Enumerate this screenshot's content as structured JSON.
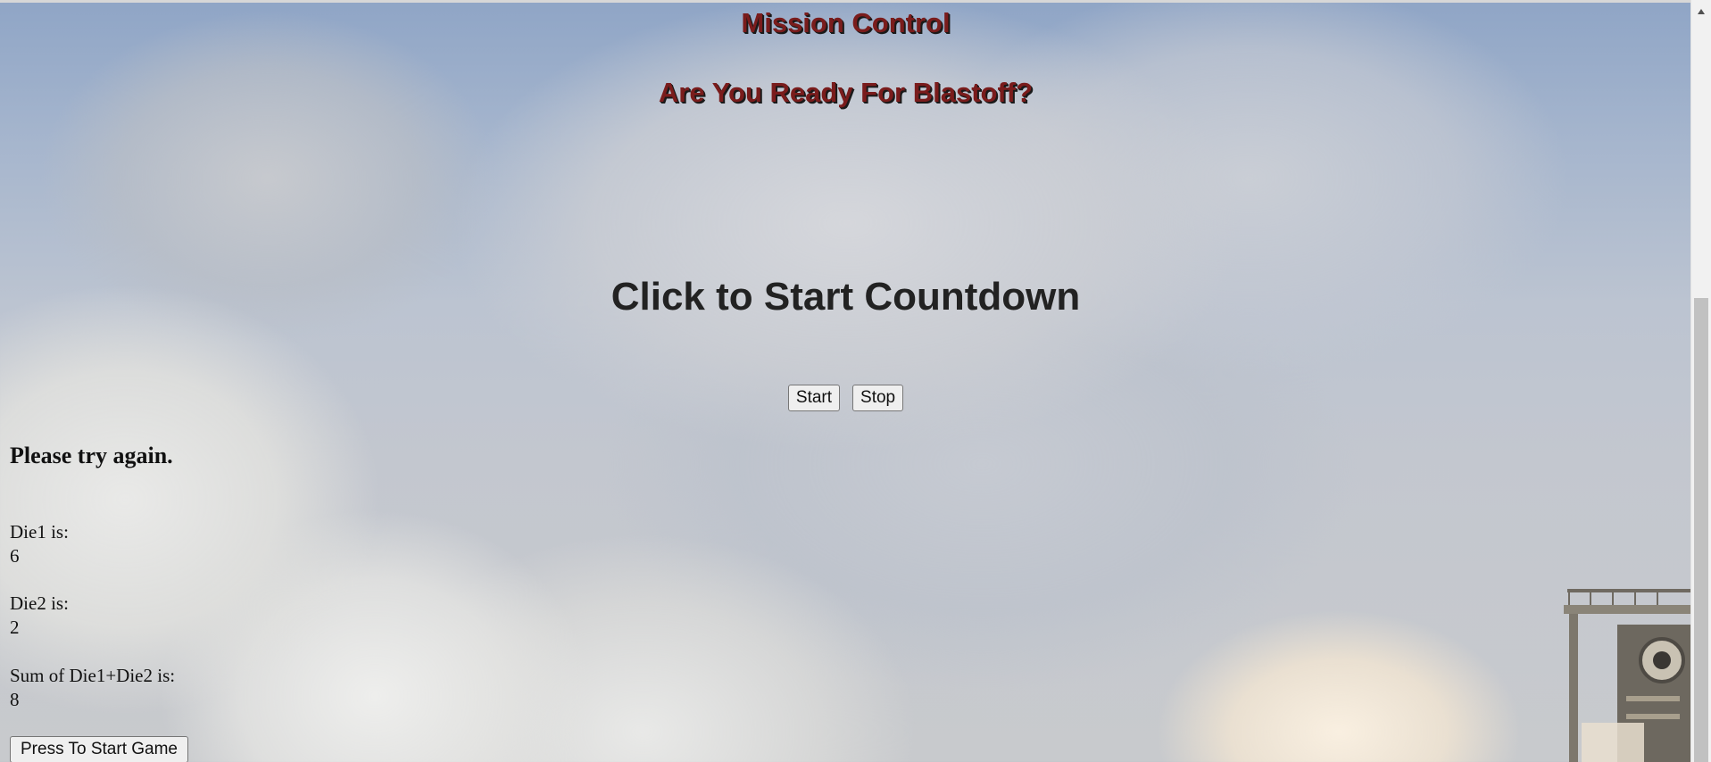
{
  "header": {
    "title": "Mission Control",
    "subtitle": "Are You Ready For Blastoff?"
  },
  "countdown": {
    "text": "Click to Start Countdown"
  },
  "controls": {
    "start_label": "Start",
    "stop_label": "Stop"
  },
  "game": {
    "message": "Please try again.",
    "die1_label": "Die1 is:",
    "die1_value": "6",
    "die2_label": "Die2 is:",
    "die2_value": "2",
    "sum_label": "Sum of Die1+Die2 is:",
    "sum_value": "8",
    "start_game_label": "Press To Start Game"
  },
  "colors": {
    "header_text": "#7a1c1c",
    "header_shadow": "#1a1a1a",
    "sky": "#8fa5c6"
  },
  "icons": {
    "scroll_up": "triangle-up-icon"
  }
}
